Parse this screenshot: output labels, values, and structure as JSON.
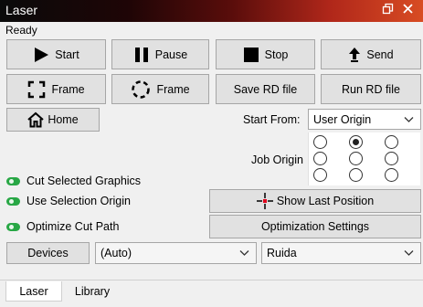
{
  "window": {
    "title": "Laser",
    "restore_icon": "restore-icon",
    "close_icon": "close-icon"
  },
  "status": "Ready",
  "buttons": {
    "start": "Start",
    "pause": "Pause",
    "stop": "Stop",
    "send": "Send",
    "frame_rect": "Frame",
    "frame_circle": "Frame",
    "save_rd": "Save RD file",
    "run_rd": "Run RD file",
    "home": "Home",
    "show_last_position": "Show Last Position",
    "optimization_settings": "Optimization Settings",
    "devices": "Devices"
  },
  "start_from": {
    "label": "Start From:",
    "value": "User Origin"
  },
  "job_origin": {
    "label": "Job Origin",
    "selected_row": 0,
    "selected_col": 1
  },
  "toggles": [
    {
      "label": "Cut Selected Graphics",
      "on": true
    },
    {
      "label": "Use Selection Origin",
      "on": true
    },
    {
      "label": "Optimize Cut Path",
      "on": true
    }
  ],
  "port_select": {
    "value": "(Auto)"
  },
  "controller_select": {
    "value": "Ruida"
  },
  "tabs": [
    {
      "label": "Laser",
      "active": true
    },
    {
      "label": "Library",
      "active": false
    }
  ],
  "colors": {
    "toggle_on": "#28a745",
    "crosshair": "#e0001b"
  }
}
